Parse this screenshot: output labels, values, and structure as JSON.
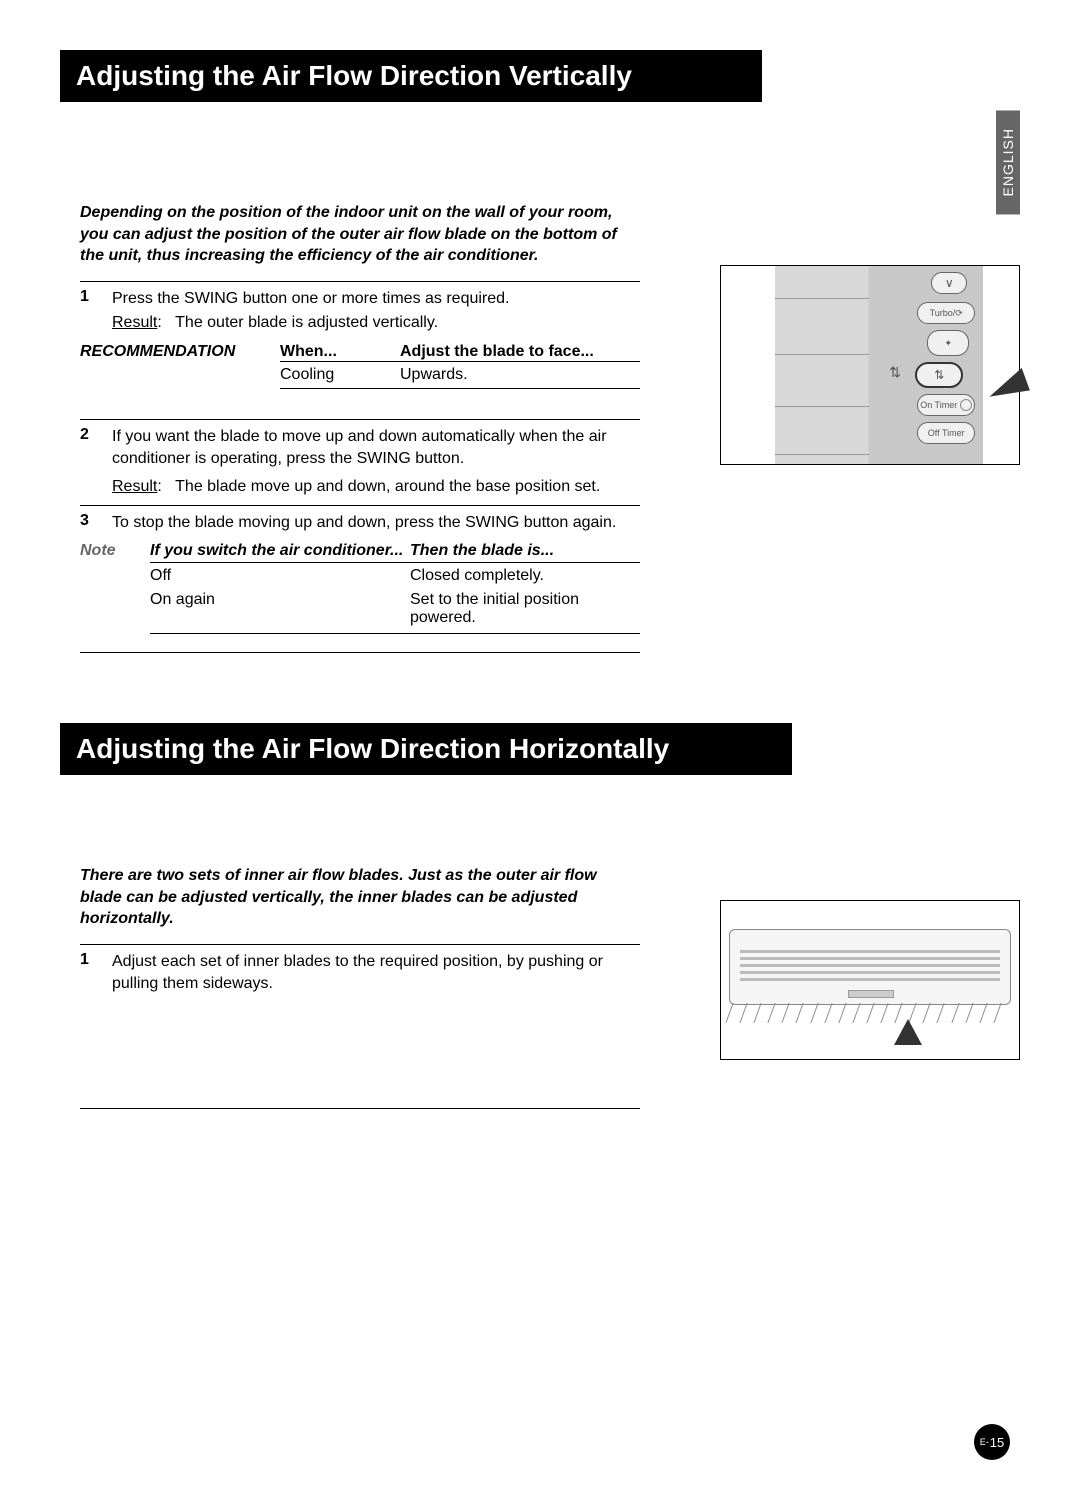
{
  "language_tab": "ENGLISH",
  "section1": {
    "heading": "Adjusting the Air Flow Direction Vertically",
    "intro": "Depending on the position of the indoor unit on the wall of your room, you can adjust the position of the outer air flow blade on the bottom of the unit, thus increasing the efficiency of the air conditioner.",
    "step1": {
      "num": "1",
      "text": "Press the SWING button one or more times as required.",
      "result_label": "Result",
      "result_text": "The outer blade is adjusted vertically."
    },
    "recommendation": {
      "label": "RECOMMENDATION",
      "col_when": "When...",
      "col_adjust": "Adjust the blade to face...",
      "row1_when": "Cooling",
      "row1_adjust": "Upwards."
    },
    "step2": {
      "num": "2",
      "text": "If you want the blade to move up and down automatically when the air conditioner is operating, press the SWING button.",
      "result_label": "Result",
      "result_text": "The blade move up and down, around the base position set."
    },
    "step3": {
      "num": "3",
      "text": "To stop the blade moving up and down, press the SWING button again."
    },
    "note": {
      "label": "Note",
      "col_if": "If you switch the air conditioner...",
      "col_then": "Then the blade is...",
      "row1_if": "Off",
      "row1_then": "Closed completely.",
      "row2_if": "On again",
      "row2_then": "Set to the initial position powered."
    }
  },
  "section2": {
    "heading": "Adjusting the Air Flow Direction Horizontally",
    "intro": "There are two sets of inner air flow blades. Just as the outer air flow blade can be adjusted vertically, the inner blades can be adjusted horizontally.",
    "step1": {
      "num": "1",
      "text": "Adjust each set of inner blades to the required position, by pushing or pulling them sideways."
    }
  },
  "remote": {
    "turbo": "Turbo/",
    "on_timer": "On Timer",
    "off_timer": "Off Timer"
  },
  "page_number_prefix": "E-",
  "page_number": "15"
}
